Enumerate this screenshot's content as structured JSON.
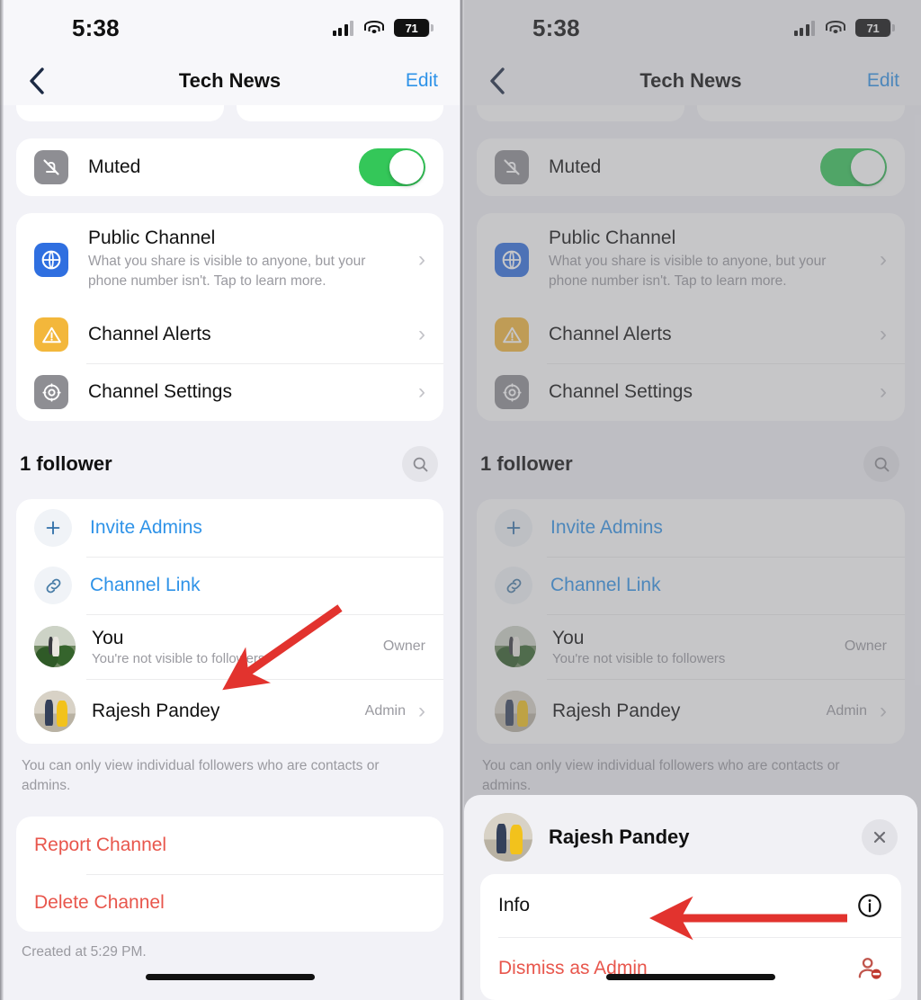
{
  "status_bar": {
    "time": "5:38",
    "battery_level": "71"
  },
  "nav": {
    "title": "Tech News",
    "edit_label": "Edit",
    "back_icon": "chevron-left-icon"
  },
  "settings": {
    "muted": {
      "label": "Muted",
      "icon": "bell-slash-icon",
      "toggle_on": true
    },
    "public_channel": {
      "title": "Public Channel",
      "subtitle": "What you share is visible to anyone, but your phone number isn't. Tap to learn more.",
      "icon": "globe-icon"
    },
    "channel_alerts": {
      "label": "Channel Alerts",
      "icon": "warning-triangle-icon"
    },
    "channel_settings": {
      "label": "Channel Settings",
      "icon": "gear-icon"
    }
  },
  "followers": {
    "section_title": "1 follower",
    "search_icon": "search-icon",
    "invite_admins": {
      "label": "Invite Admins",
      "icon": "plus-icon"
    },
    "channel_link": {
      "label": "Channel Link",
      "icon": "link-icon"
    },
    "members": [
      {
        "name": "You",
        "subtitle": "You're not visible to followers",
        "role": "Owner",
        "has_chevron": false
      },
      {
        "name": "Rajesh Pandey",
        "subtitle": "",
        "role": "Admin",
        "has_chevron": true
      }
    ],
    "footnote": "You can only view individual followers who are contacts or admins."
  },
  "danger_actions": {
    "report": "Report Channel",
    "delete": "Delete Channel"
  },
  "created_text": "Created at 5:29 PM.",
  "action_sheet": {
    "name": "Rajesh Pandey",
    "close_icon": "close-icon",
    "items": [
      {
        "label": "Info",
        "icon": "info-circle-icon",
        "destructive": false
      },
      {
        "label": "Dismiss as Admin",
        "icon": "person-minus-icon",
        "destructive": true
      }
    ]
  },
  "colors": {
    "accent_blue": "#2f93e8",
    "toggle_green": "#34c759",
    "destructive_red": "#e8564c",
    "annotation_red": "#e2332e"
  }
}
